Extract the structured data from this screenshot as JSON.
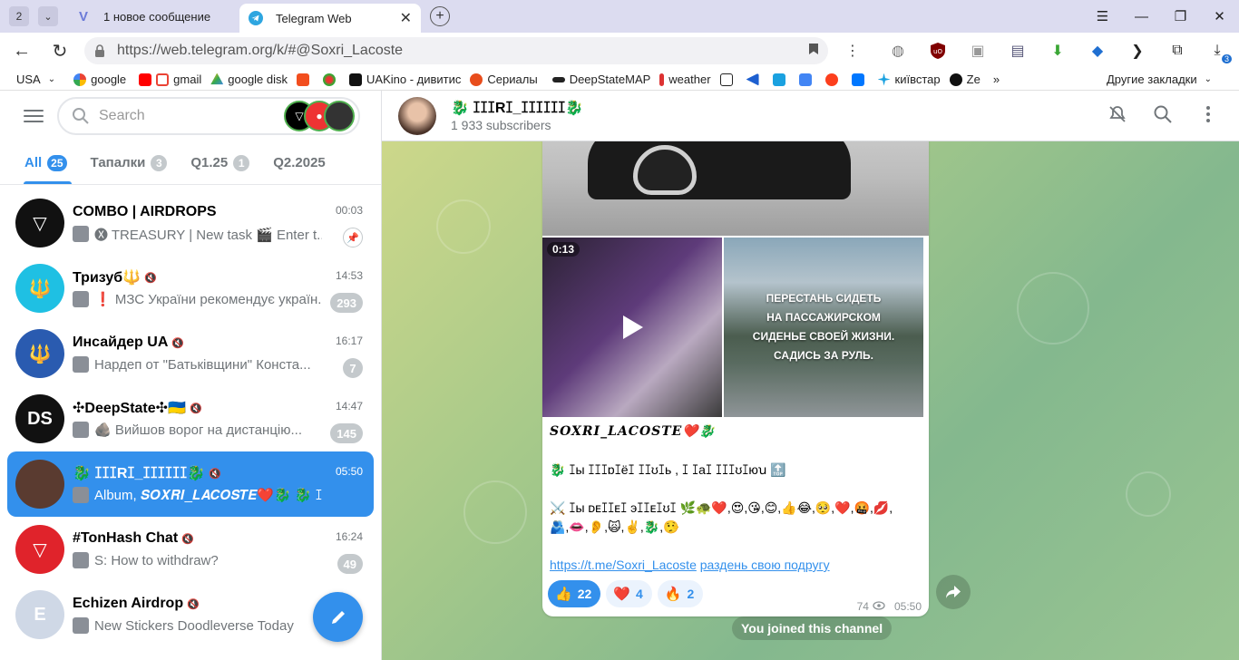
{
  "browser": {
    "tab_count": "2",
    "tabs": [
      {
        "label": "1 новое сообщение",
        "active": false
      },
      {
        "label": "Telegram Web",
        "active": true
      }
    ],
    "url": "https://web.telegram.org/k/#@Soxri_Lacoste",
    "bookmarks": [
      "USA",
      "google",
      "gmail",
      "google disk",
      "UAKino - дивитис",
      "Сериалы",
      "DeepStateMAP",
      "weather",
      "київстар",
      "Ze"
    ],
    "bookmarks_other": "Другие закладки",
    "download_badge": "3"
  },
  "sidebar": {
    "search_placeholder": "Search",
    "folders": [
      {
        "label": "All",
        "count": "25"
      },
      {
        "label": "Тапалки",
        "count": "3"
      },
      {
        "label": "Q1.25",
        "count": "1"
      },
      {
        "label": "Q2.2025",
        "count": ""
      }
    ],
    "chats": [
      {
        "title": "COMBO | AIRDROPS",
        "time": "00:03",
        "message": "🅧 TREASURY | New task 🎬 Enter t...",
        "badge": "",
        "pinned": true,
        "avatar_color": "#111111",
        "avatar_letter": "▽"
      },
      {
        "title": "Тризуб🔱",
        "time": "14:53",
        "message": "❗ МЗС України рекомендує україн...",
        "badge": "293",
        "pinned": false,
        "avatar_color": "#1fc0e3",
        "avatar_letter": "🔱"
      },
      {
        "title": "Инсайдер UA",
        "time": "16:17",
        "message": "Нардеп от \"Батьківщини\" Конста...",
        "badge": "7",
        "pinned": false,
        "avatar_color": "#2a5bb0",
        "avatar_letter": "🔱"
      },
      {
        "title": "✣DeepState✣🇺🇦",
        "time": "14:47",
        "message": "🪨 Вийшов ворог на дистанцію...",
        "badge": "145",
        "pinned": false,
        "avatar_color": "#111111",
        "avatar_letter": "DS"
      },
      {
        "title": "🐉 ꕯꕯꕯRꕯ_ꕯꕯꕯꕯꕯꕯ🐉",
        "time": "05:50",
        "message": "Album, 𝑺𝑶𝑿𝑹𝑰_𝑳𝑨𝑪𝑶𝑺𝑻𝑬❤️🐉 🐉 ꕯы ꕯꕯ...",
        "badge": "",
        "pinned": false,
        "avatar_color": "#5a3b30",
        "avatar_letter": "",
        "selected": true
      },
      {
        "title": "#TonHash Chat",
        "time": "16:24",
        "message": "S: How to withdraw?",
        "badge": "49",
        "pinned": false,
        "avatar_color": "#e0232b",
        "avatar_letter": "▽"
      },
      {
        "title": "Echizen Airdrop",
        "time": "",
        "message": "New Stickers Doodleverse Today",
        "badge": "",
        "pinned": false,
        "avatar_color": "#cfd8e6",
        "avatar_letter": "E"
      }
    ]
  },
  "channel": {
    "title": "🐉 ꕯꕯꕯRꕯ_ꕯꕯꕯꕯꕯꕯ🐉",
    "subscribers": "1 933 subscribers"
  },
  "message": {
    "video_duration": "0:13",
    "photo_text": [
      "ПЕРЕСТАНЬ СИДЕТЬ",
      "НА ПАССАЖИРСКОМ",
      "СИДЕНЬЕ СВОЕЙ ЖИЗНИ.",
      "САДИСЬ ЗА РУЛЬ."
    ],
    "caption_title": "SOXRI_LACOSTE❤️🐉",
    "caption_line2": "🐉 ꕯы ꕯꕯꕯɒꕯёꕯ ꕯꕯʊꕯь , ꕯ ꕯаꕯ ꕯꕯꕯʊꕯюꭒ 🔝",
    "caption_line3": "⚔️ ꕯы ᴅᴇꕯꕯᴇꕯ эꕯꕯᴇꕯʊꕯ 🌿🐢❤️,😍,😘,😊,👍😂,🥺,❤️,🤬,💋,",
    "caption_line4": "🫂,👄,👂,🙀,✌️,🐉,🤥",
    "link": "https://t.me/Soxri_Lacoste",
    "link_text": "раздень свою подругу",
    "reactions": [
      {
        "emoji": "👍",
        "count": "22",
        "mine": true
      },
      {
        "emoji": "❤️",
        "count": "4",
        "mine": false
      },
      {
        "emoji": "🔥",
        "count": "2",
        "mine": false
      }
    ],
    "views": "74",
    "time": "05:50"
  },
  "service_message": "You joined this channel",
  "colors": {
    "accent": "#3390ec",
    "badge_muted": "#c4c9cc"
  }
}
